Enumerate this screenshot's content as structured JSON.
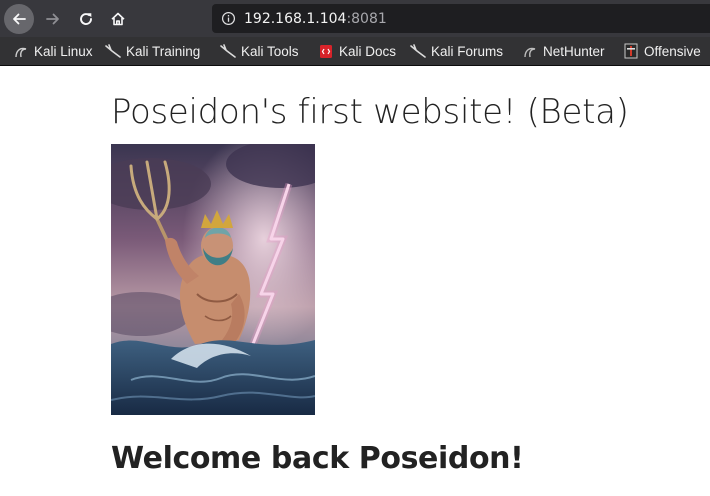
{
  "browser": {
    "url_host": "192.168.1.104",
    "url_port": ":8081"
  },
  "bookmarks": [
    {
      "label": "Kali Linux",
      "icon": "kali-dragon-icon"
    },
    {
      "label": "Kali Training",
      "icon": "kali-dragon-icon"
    },
    {
      "label": "Kali Tools",
      "icon": "kali-dragon-icon"
    },
    {
      "label": "Kali Docs",
      "icon": "kali-docs-icon"
    },
    {
      "label": "Kali Forums",
      "icon": "kali-dragon-icon"
    },
    {
      "label": "NetHunter",
      "icon": "nethunter-icon"
    },
    {
      "label": "Offensive",
      "icon": "offensive-security-icon"
    }
  ],
  "page": {
    "title": "Poseidon's first website! (Beta)",
    "welcome": "Welcome back Poseidon!"
  },
  "colors": {
    "toolbar": "#38383d",
    "urlbar": "#1e1e21",
    "bookmarks_bar": "#323234",
    "text": "#222222"
  }
}
